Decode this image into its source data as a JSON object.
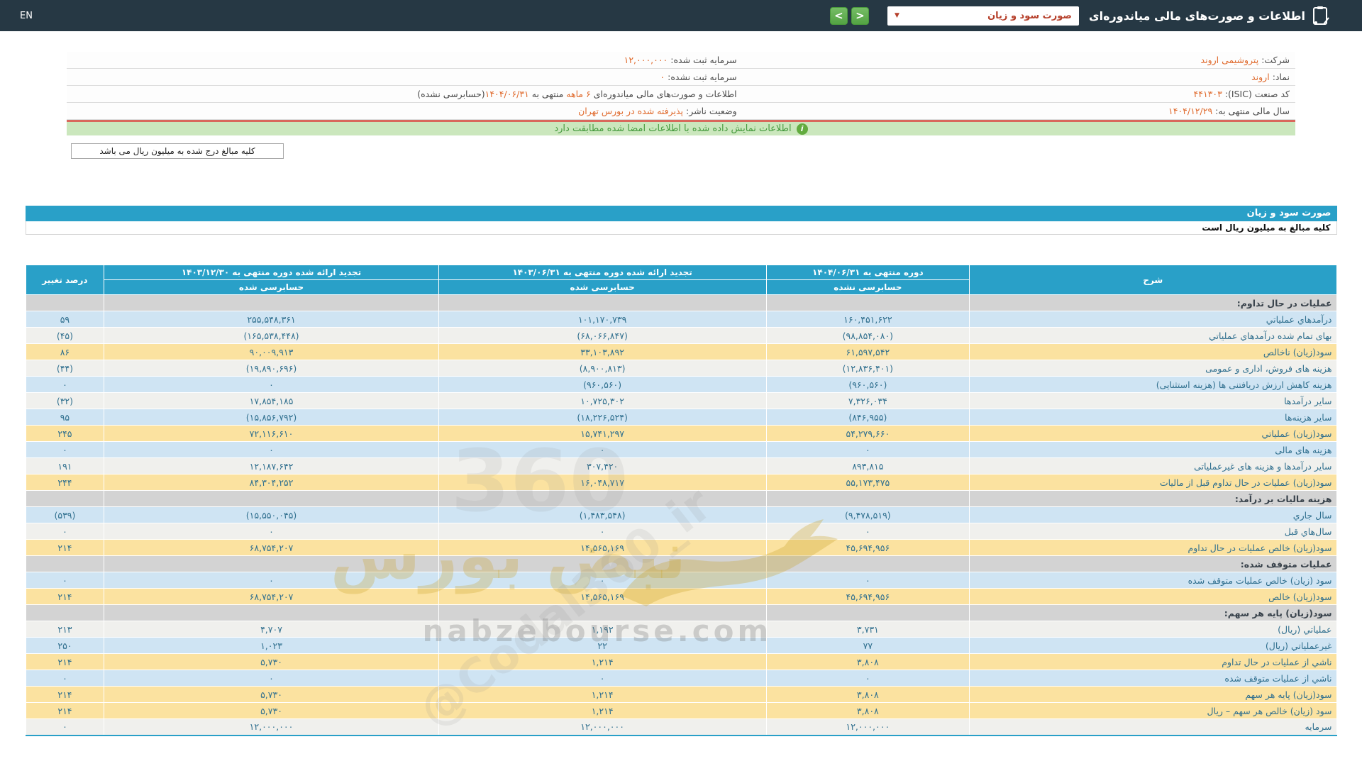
{
  "navbar": {
    "title": "اطلاعات و صورت‌های مالی میاندوره‌ای",
    "report_select_value": "صورت سود و زیان",
    "caret": "▼",
    "next_button": ">",
    "prev_button": "<",
    "en_label": "EN"
  },
  "company_info": {
    "right_column": [
      {
        "label": "شرکت:",
        "value": "پتروشیمی اروند"
      },
      {
        "label": "نماد:",
        "value": "اروند"
      },
      {
        "label": "کد صنعت (ISIC):",
        "value": "۴۴۱۳۰۳"
      },
      {
        "label": "سال مالی منتهی به:",
        "value": "۱۴۰۴/۱۲/۲۹"
      }
    ],
    "left_column": [
      {
        "label": "سرمایه ثبت شده:",
        "value": "۱۲,۰۰۰,۰۰۰"
      },
      {
        "label": "سرمایه ثبت نشده:",
        "value": "۰"
      },
      {
        "parts": [
          {
            "t": "اطلاعات و صورت‌های مالی میاندوره‌ای ",
            "hl": false
          },
          {
            "t": "۶ ماهه",
            "hl": true
          },
          {
            "t": " منتهی به ",
            "hl": false
          },
          {
            "t": "۱۴۰۴/۰۶/۳۱",
            "hl": true
          },
          {
            "t": "(حسابرسی نشده)",
            "hl": false
          }
        ]
      },
      {
        "label": "وضعیت ناشر:",
        "value": "پذیرفته شده در بورس تهران"
      }
    ]
  },
  "notice": {
    "text": "اطلاعات نمایش داده شده با اطلاعات امضا شده مطابقت دارد",
    "icon": "i"
  },
  "million_note": "کلیه مبالغ درج شده به میلیون ریال می باشد",
  "statement": {
    "title": "صورت سود و زیان",
    "unit_note": "کلیه مبالغ به میلیون ریال است",
    "header": {
      "desc": "شرح",
      "col1_title": "دوره منتهی به ۱۴۰۴/۰۶/۳۱",
      "col1_sub": "حسابرسی نشده",
      "col2_title": "تجدید ارائه شده دوره منتهی به ۱۴۰۳/۰۶/۳۱",
      "col2_sub": "حسابرسی شده",
      "col3_title": "تجدید ارائه شده دوره منتهی به ۱۴۰۳/۱۲/۳۰",
      "col3_sub": "حسابرسی شده",
      "pct": "درصد تغییر"
    },
    "rows": [
      {
        "type": "section",
        "label": "عملیات در حال تداوم:"
      },
      {
        "type": "data",
        "bg": "blue",
        "label": "درآمدهاي عملياتي",
        "v1": "۱۶۰,۴۵۱,۶۲۲",
        "v2": "۱۰۱,۱۷۰,۷۳۹",
        "v3": "۲۵۵,۵۴۸,۳۶۱",
        "pct": "۵۹"
      },
      {
        "type": "data",
        "bg": "plain",
        "label": "بهای تمام شده درآمدهاي عملياتي",
        "v1": "(۹۸,۸۵۴,۰۸۰)",
        "v2": "(۶۸,۰۶۶,۸۴۷)",
        "v3": "(۱۶۵,۵۳۸,۴۴۸)",
        "pct": "(۴۵)"
      },
      {
        "type": "data",
        "bg": "yellow",
        "label": "سود(زيان) ناخالص",
        "v1": "۶۱,۵۹۷,۵۴۲",
        "v2": "۳۳,۱۰۳,۸۹۲",
        "v3": "۹۰,۰۰۹,۹۱۳",
        "pct": "۸۶"
      },
      {
        "type": "data",
        "bg": "plain",
        "label": "هزینه های فروش، اداری و عمومی",
        "v1": "(۱۲,۸۳۶,۴۰۱)",
        "v2": "(۸,۹۰۰,۸۱۳)",
        "v3": "(۱۹,۸۹۰,۶۹۶)",
        "pct": "(۴۴)"
      },
      {
        "type": "data",
        "bg": "blue",
        "label": "هزینه کاهش ارزش دریافتنی ها (هزینه استثنایی)",
        "v1": "(۹۶۰,۵۶۰)",
        "v2": "(۹۶۰,۵۶۰)",
        "v3": "۰",
        "pct": "۰"
      },
      {
        "type": "data",
        "bg": "plain",
        "label": "سایر درآمدها",
        "v1": "۷,۳۲۶,۰۳۴",
        "v2": "۱۰,۷۲۵,۳۰۲",
        "v3": "۱۷,۸۵۴,۱۸۵",
        "pct": "(۳۲)"
      },
      {
        "type": "data",
        "bg": "blue",
        "label": "سایر هزینه‌ها",
        "v1": "(۸۴۶,۹۵۵)",
        "v2": "(۱۸,۲۲۶,۵۲۴)",
        "v3": "(۱۵,۸۵۶,۷۹۲)",
        "pct": "۹۵"
      },
      {
        "type": "data",
        "bg": "yellow",
        "label": "سود(زيان) عملياتي",
        "v1": "۵۴,۲۷۹,۶۶۰",
        "v2": "۱۵,۷۴۱,۲۹۷",
        "v3": "۷۲,۱۱۶,۶۱۰",
        "pct": "۲۴۵"
      },
      {
        "type": "data",
        "bg": "blue",
        "label": "هزينه هاى مالى",
        "v1": "۰",
        "v2": "۰",
        "v3": "۰",
        "pct": "۰"
      },
      {
        "type": "data",
        "bg": "plain",
        "label": "سایر درآمدها و هزینه های غیرعملیاتی",
        "v1": "۸۹۳,۸۱۵",
        "v2": "۳۰۷,۴۲۰",
        "v3": "۱۲,۱۸۷,۶۴۲",
        "pct": "۱۹۱"
      },
      {
        "type": "data",
        "bg": "yellow",
        "label": "سود(زیان) عملیات در حال تداوم قبل از مالیات",
        "v1": "۵۵,۱۷۳,۴۷۵",
        "v2": "۱۶,۰۴۸,۷۱۷",
        "v3": "۸۴,۳۰۴,۲۵۲",
        "pct": "۲۴۴"
      },
      {
        "type": "section",
        "label": "هزینه مالیات بر درآمد:"
      },
      {
        "type": "data",
        "bg": "blue",
        "label": "سال جاري",
        "v1": "(۹,۴۷۸,۵۱۹)",
        "v2": "(۱,۴۸۳,۵۴۸)",
        "v3": "(۱۵,۵۵۰,۰۴۵)",
        "pct": "(۵۳۹)"
      },
      {
        "type": "data",
        "bg": "plain",
        "label": "سال‌هاي قبل",
        "v1": "۰",
        "v2": "۰",
        "v3": "۰",
        "pct": "۰"
      },
      {
        "type": "data",
        "bg": "yellow",
        "label": "سود(زیان) خالص عملیات در حال تداوم",
        "v1": "۴۵,۶۹۴,۹۵۶",
        "v2": "۱۴,۵۶۵,۱۶۹",
        "v3": "۶۸,۷۵۴,۲۰۷",
        "pct": "۲۱۴"
      },
      {
        "type": "section",
        "label": "عملیات متوقف شده:"
      },
      {
        "type": "data",
        "bg": "blue",
        "label": "سود (زیان) خالص عملیات متوقف شده",
        "v1": "۰",
        "v2": "۰",
        "v3": "۰",
        "pct": "۰"
      },
      {
        "type": "data",
        "bg": "yellow",
        "label": "سود(زیان) خالص",
        "v1": "۴۵,۶۹۴,۹۵۶",
        "v2": "۱۴,۵۶۵,۱۶۹",
        "v3": "۶۸,۷۵۴,۲۰۷",
        "pct": "۲۱۴"
      },
      {
        "type": "section",
        "label": "سود(زیان) پایه هر سهم:"
      },
      {
        "type": "data",
        "bg": "plain",
        "label": "عملیاتي (ریال)",
        "v1": "۳,۷۳۱",
        "v2": "۱,۱۹۲",
        "v3": "۴,۷۰۷",
        "pct": "۲۱۳"
      },
      {
        "type": "data",
        "bg": "blue",
        "label": "غیرعملیاتي (ریال)",
        "v1": "۷۷",
        "v2": "۲۲",
        "v3": "۱,۰۲۳",
        "pct": "۲۵۰"
      },
      {
        "type": "data",
        "bg": "yellow",
        "label": "ناشي از عملیات در حال تداوم",
        "v1": "۳,۸۰۸",
        "v2": "۱,۲۱۴",
        "v3": "۵,۷۳۰",
        "pct": "۲۱۴"
      },
      {
        "type": "data",
        "bg": "blue",
        "label": "ناشي از عملیات متوقف شده",
        "v1": "۰",
        "v2": "۰",
        "v3": "۰",
        "pct": "۰"
      },
      {
        "type": "data",
        "bg": "yellow",
        "label": "سود(زیان) پایه هر سهم",
        "v1": "۳,۸۰۸",
        "v2": "۱,۲۱۴",
        "v3": "۵,۷۳۰",
        "pct": "۲۱۴"
      },
      {
        "type": "data",
        "bg": "yellow",
        "label": "سود (زیان) خالص هر سهم – ریال",
        "v1": "۳,۸۰۸",
        "v2": "۱,۲۱۴",
        "v3": "۵,۷۳۰",
        "pct": "۲۱۴"
      },
      {
        "type": "data",
        "bg": "plain",
        "label": "سرمایه",
        "v1": "۱۲,۰۰۰,۰۰۰",
        "v2": "۱۲,۰۰۰,۰۰۰",
        "v3": "۱۲,۰۰۰,۰۰۰",
        "pct": "۰"
      }
    ]
  },
  "watermark": {
    "big_360": "360",
    "brand_fa": "نبض بورس",
    "brand_url": "nabzebourse.com",
    "handle": "@Codal360_ir"
  },
  "colors": {
    "navbar_bg": "#263844",
    "header_blue": "#29a0c8",
    "row_blue": "#cfe4f3",
    "row_yellow": "#fbe2a0",
    "row_section": "#d3d3d3",
    "negative_red": "#e0322c",
    "value_teal": "#31708f",
    "info_value_orange": "#e06b2e",
    "notice_green_bg": "#cbe7bd",
    "notice_border_salmon": "#d9685c"
  }
}
